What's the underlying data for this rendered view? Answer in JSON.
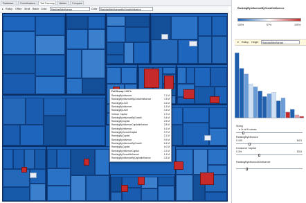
{
  "tabs": [
    "Database",
    "Coordinations",
    "Tab Treemap",
    "Hidden",
    "Compare"
  ],
  "active_tab": 2,
  "toolbar": {
    "items": [
      "Rollup",
      "Office",
      "Stroll",
      "Batch",
      "Color"
    ],
    "dropdown1": "RankingByInfluence",
    "by_label": "Color",
    "dropdown2": "RankingByInfluenceByGrowthInfluence"
  },
  "legend": {
    "title": "RankingByInfluenceByGrowthInfluence",
    "ticks": [
      "100%",
      "97%",
      "100%"
    ],
    "colors": {
      "low": "#1c62b7",
      "mid": "#ffffff",
      "high": "#c62a2a"
    }
  },
  "chart_panel": {
    "controls": [
      "Rollup",
      "Height"
    ],
    "dropdown": "RankingByInfluence",
    "chart_data": {
      "type": "bar",
      "values": [
        92,
        70,
        62,
        48,
        44,
        38,
        30,
        34,
        36,
        24,
        28,
        8,
        12,
        4,
        2
      ],
      "colors": [
        "#1f5fae",
        "#1f5fae",
        "#6a9bd4",
        "#cfe0f2",
        "#6a9bd4",
        "#1f5fae",
        "#1f5fae",
        "#6a9bd4",
        "#cfe0f2",
        "#1f5fae",
        "#6a9bd4",
        "#c62a2a",
        "#1f5fae",
        "#e59a9a",
        "#c62a2a"
      ],
      "ylim": [
        0,
        100
      ]
    }
  },
  "filters": [
    {
      "label": "Sizing",
      "value": "% of fit values",
      "min": "",
      "max": "",
      "pos": 0.1
    },
    {
      "label": "RankingByInfluence",
      "value": "",
      "min": "0.100",
      "max": "$4.5",
      "pos": 0.2
    },
    {
      "label": "Consumer Capital",
      "value": "",
      "min": "0.3%",
      "max": "$3.8",
      "pos": 0.35
    },
    {
      "label": "RankingByInfluenceInInfluence",
      "value": "",
      "min": "",
      "max": "",
      "pos": 0.15
    }
  ],
  "tooltip": {
    "title": "Full Group: 1.00 %",
    "rows": [
      {
        "k": "RankingByInfluence",
        "v": "7.1 M"
      },
      {
        "k": "RankingByInfluenceByGrowthInfluence",
        "v": "7.8 M"
      },
      {
        "k": "RankingByLevel",
        "v": "3.1 M"
      },
      {
        "k": "RankingByInfluence",
        "v": "1.3 M"
      },
      {
        "k": "RankingByLevel",
        "v": "0.3 M"
      },
      {
        "k": "Venture Capital",
        "v": "1.9 M"
      },
      {
        "k": "RankingByInfluenceByGrowth",
        "v": "4.4 M"
      },
      {
        "k": "RankingByCapital",
        "v": "2.5 M"
      },
      {
        "k": "RankingByInfluenceCapitalInfluence",
        "v": "2.8 M"
      },
      {
        "k": "RankingByInfluence",
        "v": "1.6 M"
      },
      {
        "k": "RankingByGrowthCapital",
        "v": "3.7 M"
      },
      {
        "k": "RankingByCapital",
        "v": "2.1 M"
      },
      {
        "k": "RankingByInfluence",
        "v": "0.9 M"
      },
      {
        "k": "RankingByInfluenceByGrowth",
        "v": "6.4 M"
      },
      {
        "k": "RankingByCapital",
        "v": "4.0 M"
      },
      {
        "k": "RankingByInfluenceCapital",
        "v": "2.2 M"
      },
      {
        "k": "RankingByGrowthInfluence",
        "v": "1.4 M"
      },
      {
        "k": "RankingByInfluenceByCapitalInfluence",
        "v": "3.3 M"
      }
    ]
  }
}
